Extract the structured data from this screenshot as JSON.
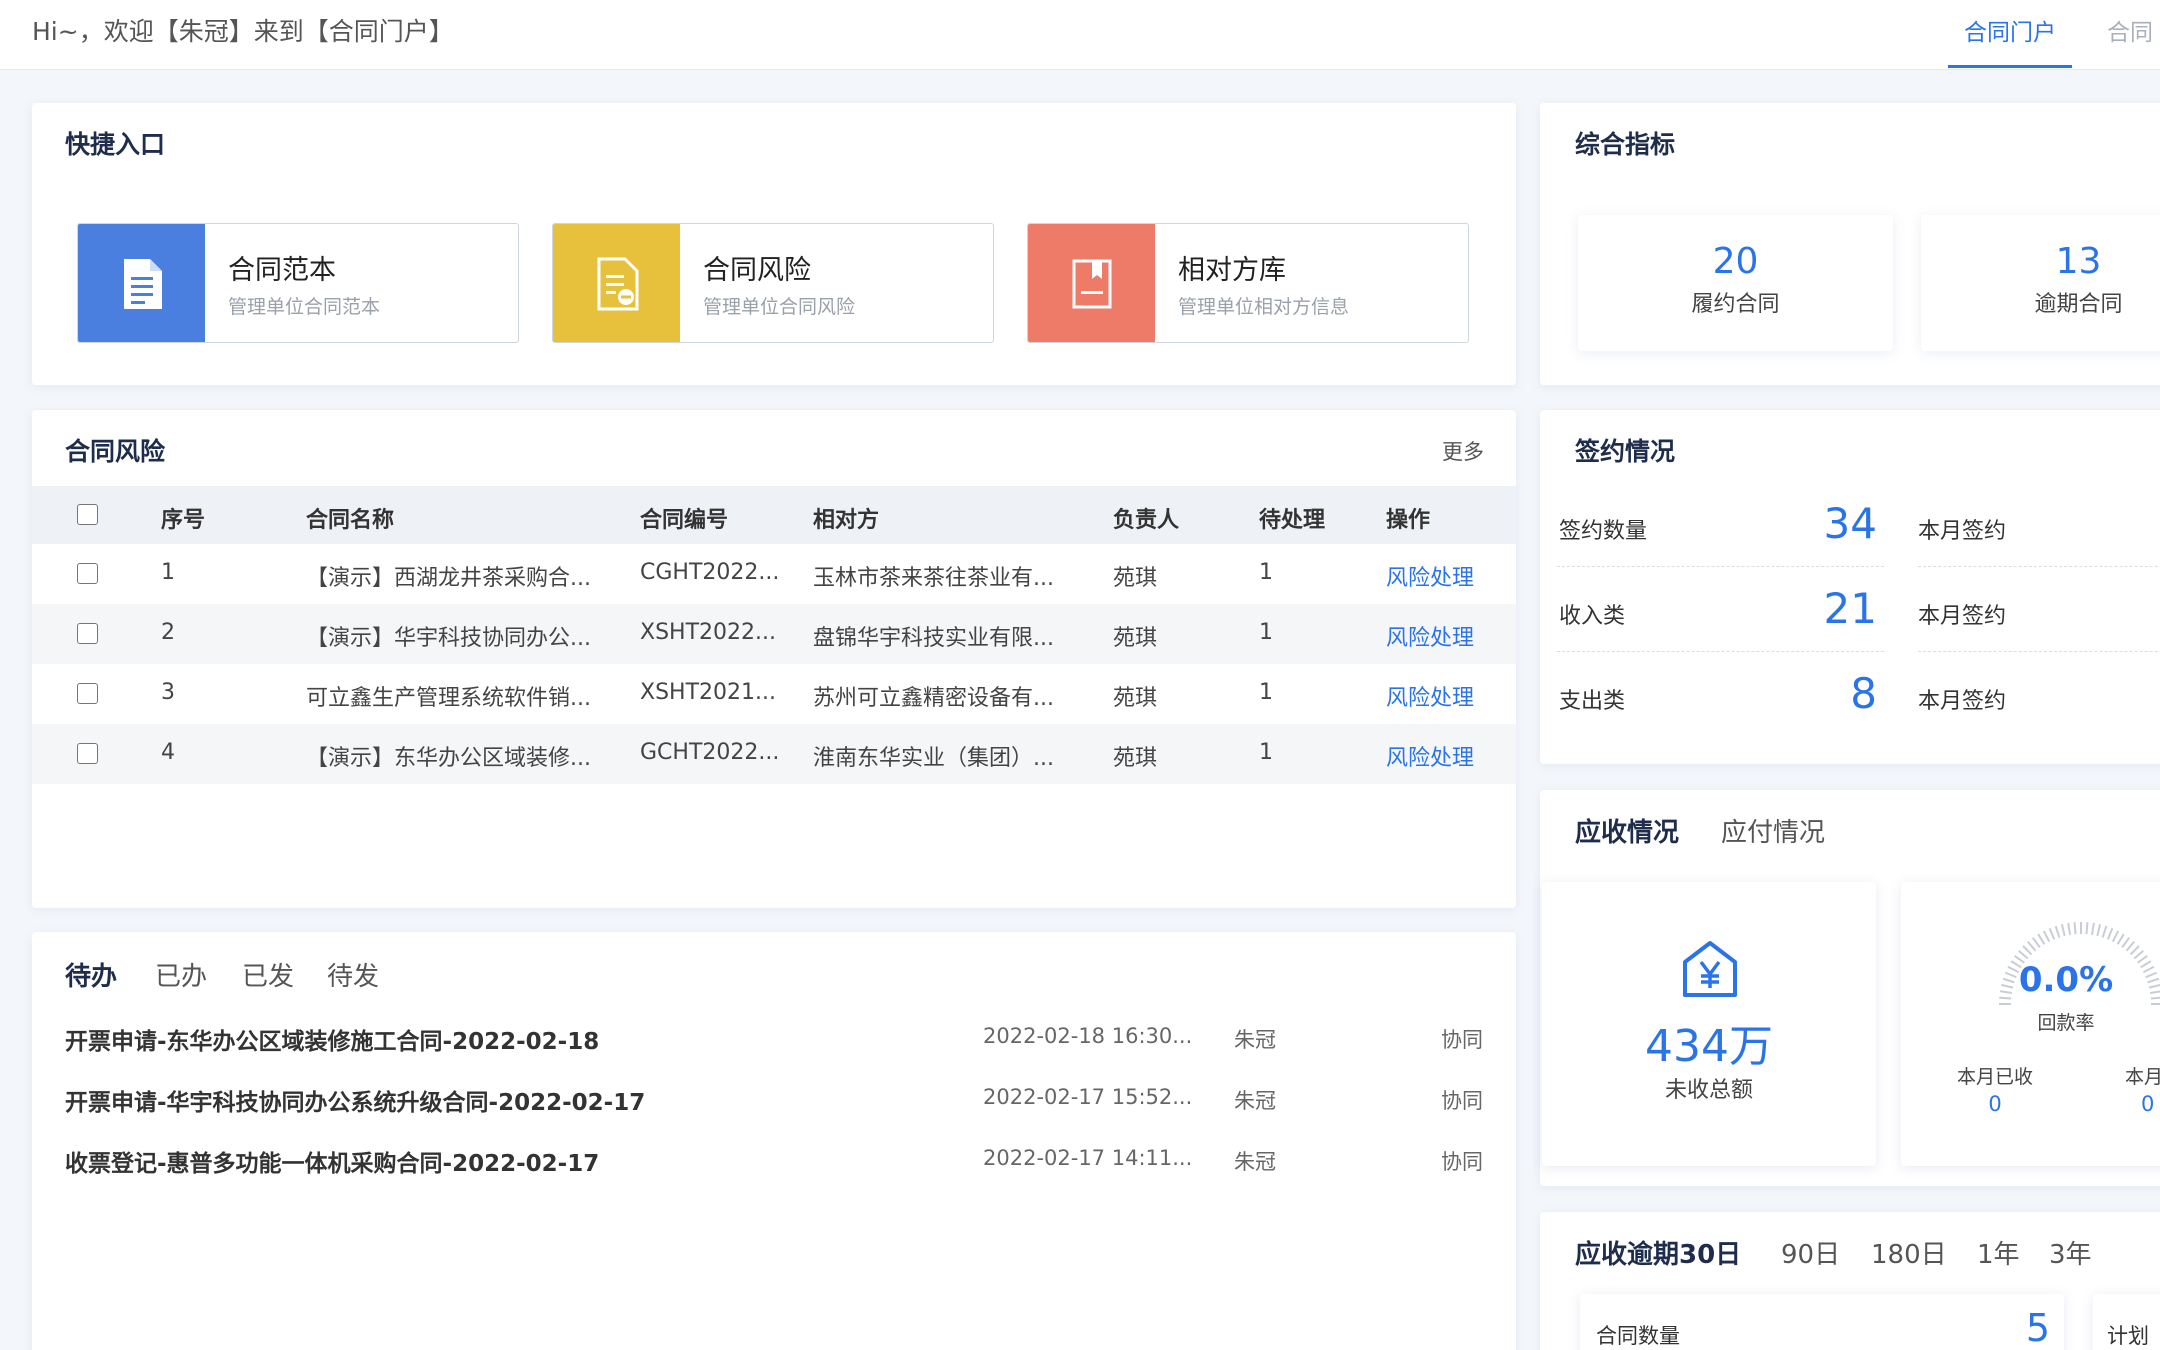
{
  "header": {
    "welcome": "Hi~，欢迎【朱冠】来到【合同门户】",
    "tabs": [
      {
        "label": "合同门户"
      },
      {
        "label": "合同"
      }
    ]
  },
  "quick": {
    "title": "快捷入口",
    "items": [
      {
        "name": "合同范本",
        "desc": "管理单位合同范本",
        "color": "#4a7fe0"
      },
      {
        "name": "合同风险",
        "desc": "管理单位合同风险",
        "color": "#e8c13c"
      },
      {
        "name": "相对方库",
        "desc": "管理单位相对方信息",
        "color": "#ee7b68"
      }
    ]
  },
  "risk": {
    "title": "合同风险",
    "more": "更多",
    "columns": [
      "序号",
      "合同名称",
      "合同编号",
      "相对方",
      "负责人",
      "待处理",
      "操作"
    ],
    "rows": [
      {
        "no": "1",
        "name": "【演示】西湖龙井茶采购合...",
        "code": "CGHT2022...",
        "party": "玉林市茶来茶往茶业有...",
        "owner": "苑琪",
        "pending": "1",
        "action": "风险处理"
      },
      {
        "no": "2",
        "name": "【演示】华宇科技协同办公...",
        "code": "XSHT2022...",
        "party": "盘锦华宇科技实业有限...",
        "owner": "苑琪",
        "pending": "1",
        "action": "风险处理"
      },
      {
        "no": "3",
        "name": "可立鑫生产管理系统软件销...",
        "code": "XSHT2021...",
        "party": "苏州可立鑫精密设备有...",
        "owner": "苑琪",
        "pending": "1",
        "action": "风险处理"
      },
      {
        "no": "4",
        "name": "【演示】东华办公区域装修...",
        "code": "GCHT2022...",
        "party": "淮南东华实业（集团）...",
        "owner": "苑琪",
        "pending": "1",
        "action": "风险处理"
      }
    ]
  },
  "todo": {
    "tabs": [
      "待办",
      "已办",
      "已发",
      "待发"
    ],
    "items": [
      {
        "title": "开票申请-东华办公区域装修施工合同-2022-02-18",
        "time": "2022-02-18 16:30...",
        "user": "朱冠",
        "type": "协同"
      },
      {
        "title": "开票申请-华宇科技协同办公系统升级合同-2022-02-17",
        "time": "2022-02-17 15:52...",
        "user": "朱冠",
        "type": "协同"
      },
      {
        "title": "收票登记-惠普多功能一体机采购合同-2022-02-17",
        "time": "2022-02-17 14:11...",
        "user": "朱冠",
        "type": "协同"
      }
    ]
  },
  "indicators": {
    "title": "综合指标",
    "items": [
      {
        "value": "20",
        "label": "履约合同"
      },
      {
        "value": "13",
        "label": "逾期合同"
      }
    ]
  },
  "signing": {
    "title": "签约情况",
    "rows": [
      {
        "label": "签约数量",
        "value": "34",
        "month": "本月签约"
      },
      {
        "label": "收入类",
        "value": "21",
        "month": "本月签约"
      },
      {
        "label": "支出类",
        "value": "8",
        "month": "本月签约"
      }
    ]
  },
  "receivable": {
    "tabs": [
      "应收情况",
      "应付情况"
    ],
    "total_value": "434万",
    "total_label": "未收总额",
    "rate_value": "0.0%",
    "rate_label": "回款率",
    "rate_fraction": 0.0,
    "month_received_label": "本月已收",
    "month_received_value": "0",
    "month_plan_label": "本月",
    "month_plan_value": "0"
  },
  "overdue": {
    "tabs": [
      "应收逾期30日",
      "90日",
      "180日",
      "1年",
      "3年"
    ],
    "count_label": "合同数量",
    "count_value": "5",
    "plan_label": "计划"
  }
}
